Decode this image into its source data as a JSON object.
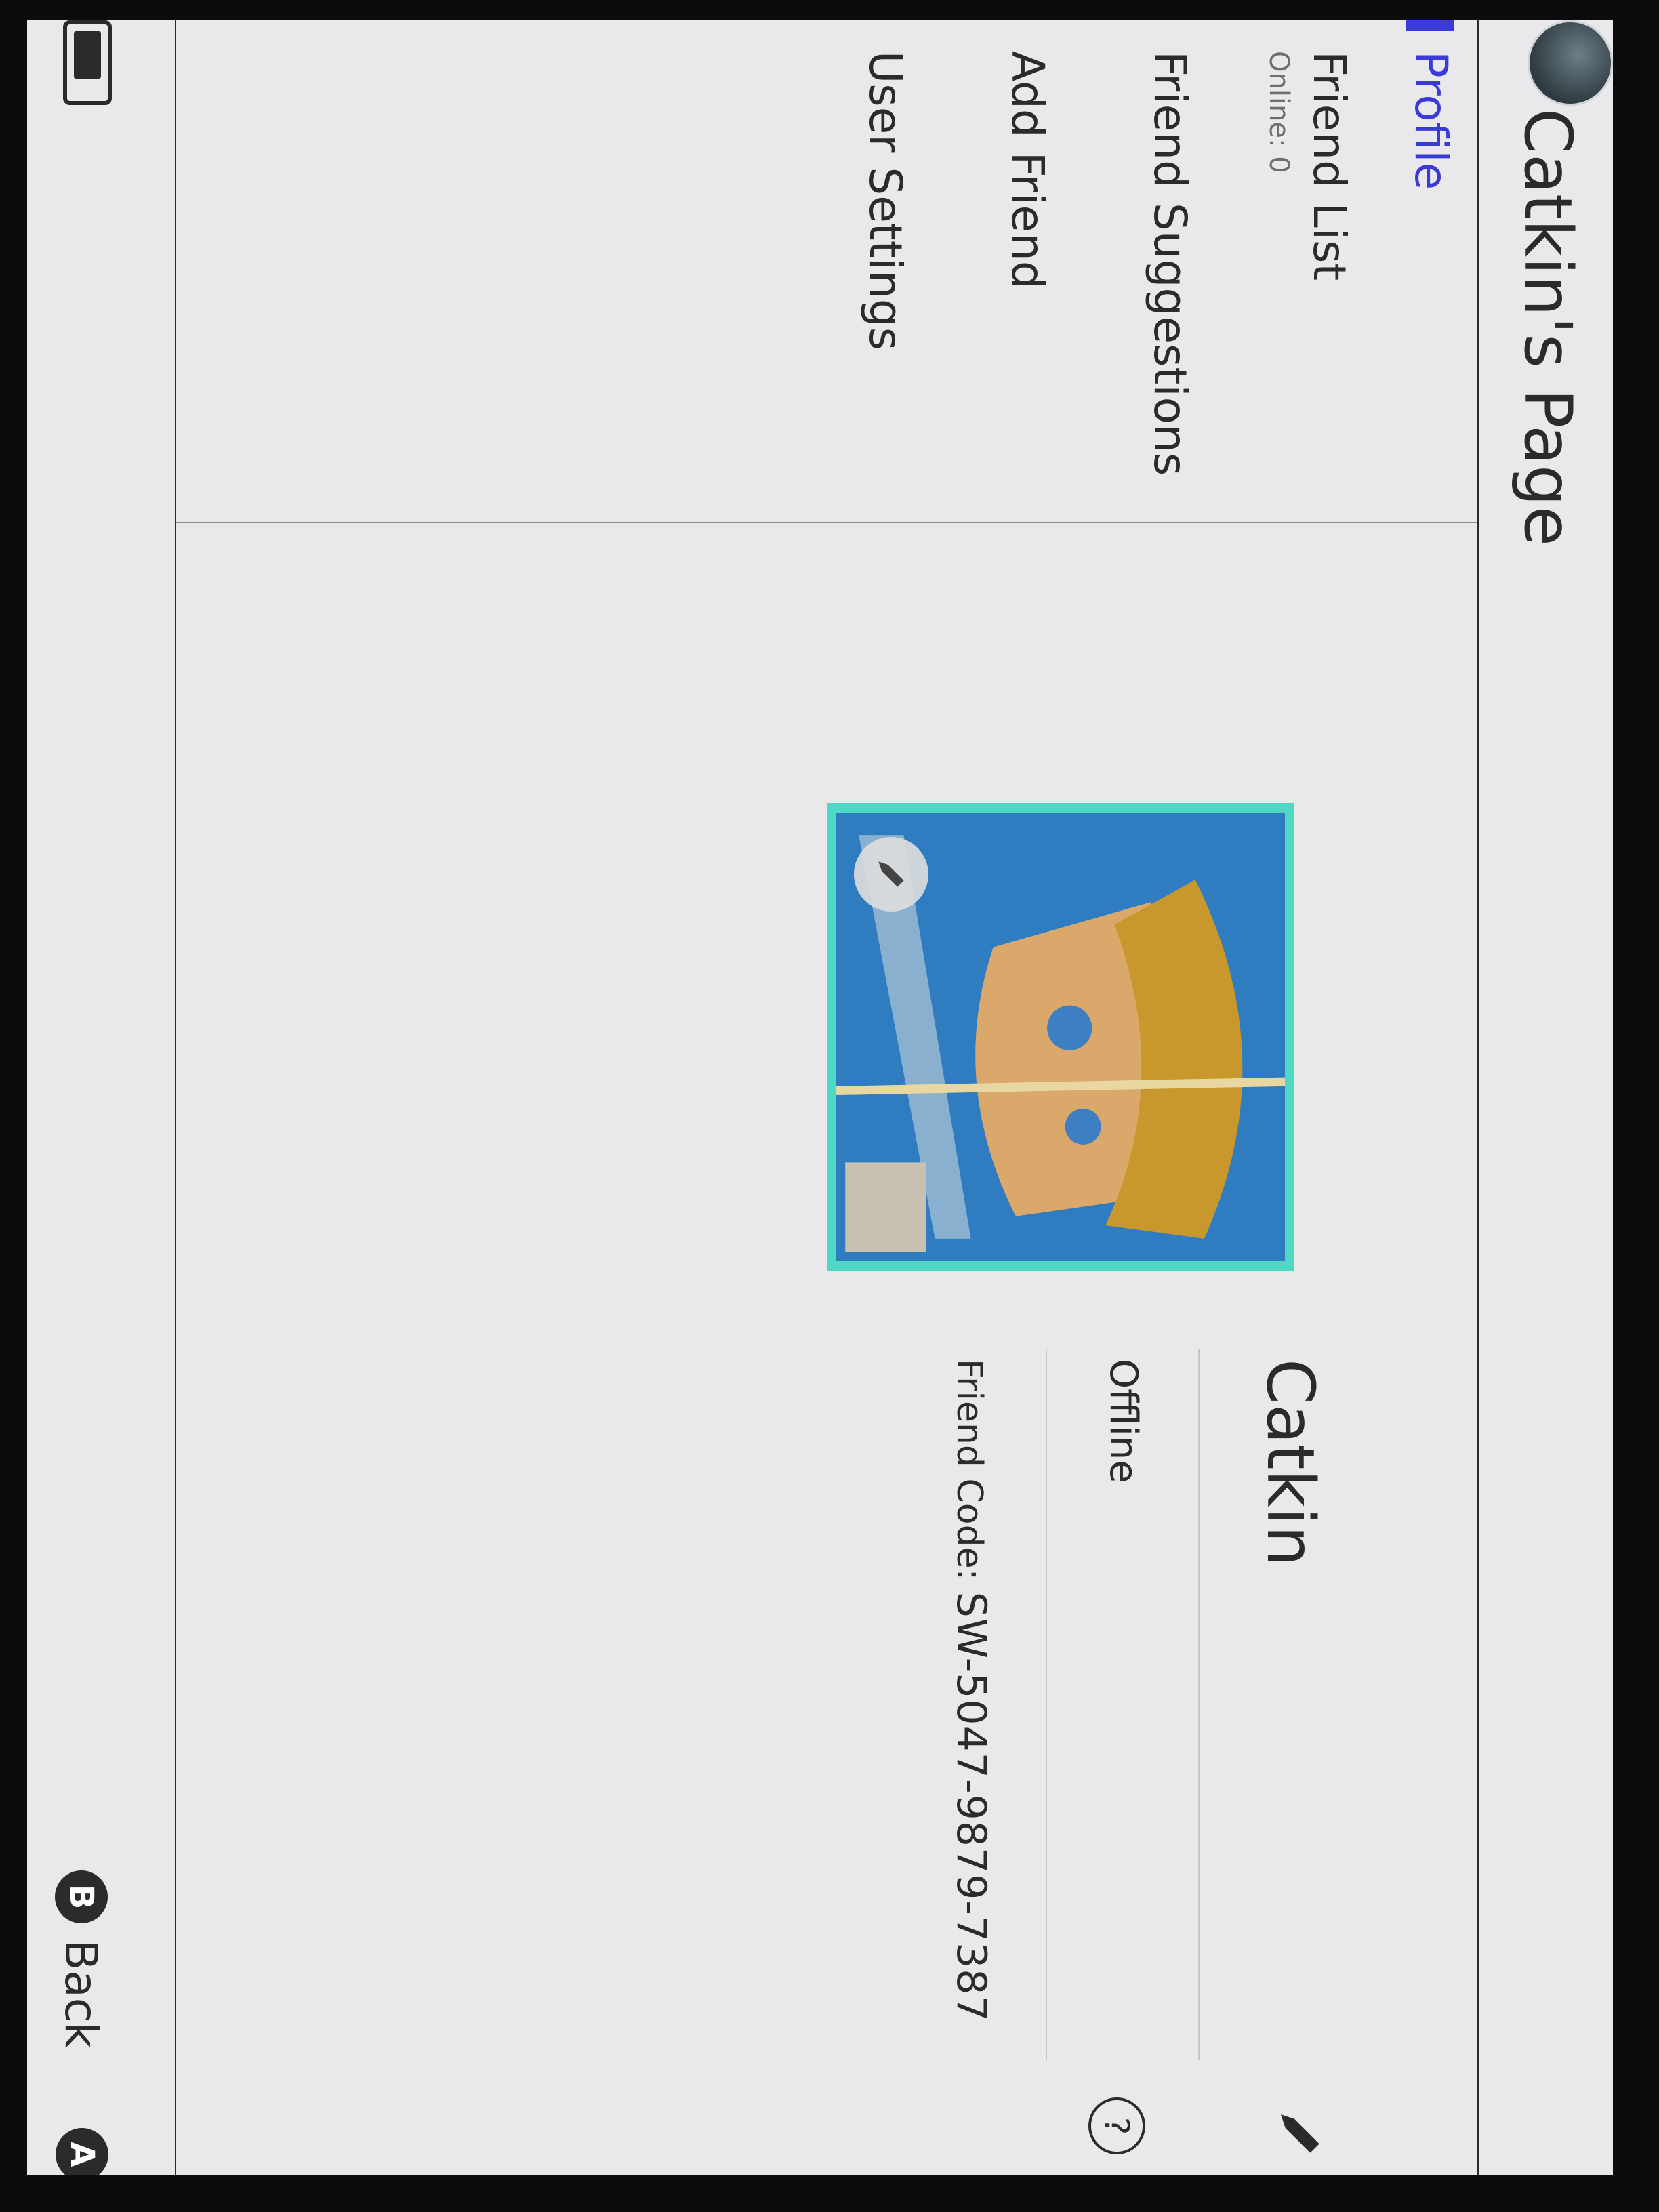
{
  "header": {
    "title": "Catkin's Page"
  },
  "sidebar": {
    "items": [
      {
        "label": "Profile",
        "selected": true
      },
      {
        "label": "Friend List",
        "sublabel": "Online: 0"
      },
      {
        "label": "Friend Suggestions"
      },
      {
        "label": "Add Friend"
      },
      {
        "label": "User Settings"
      }
    ]
  },
  "profile": {
    "name": "Catkin",
    "status": "Offline",
    "friend_code_label": "Friend Code:",
    "friend_code": "SW-5047-9879-7387"
  },
  "footer": {
    "back_key": "B",
    "back_label": "Back",
    "a_key": "A"
  },
  "icons": {
    "edit_name": "pencil-icon",
    "edit_avatar": "pencil-icon",
    "help": "question-icon",
    "device": "handheld-mode-icon"
  },
  "colors": {
    "accent": "#3a3ad8",
    "avatar_border": "#4fd8c4",
    "background": "#e9e8ea"
  }
}
